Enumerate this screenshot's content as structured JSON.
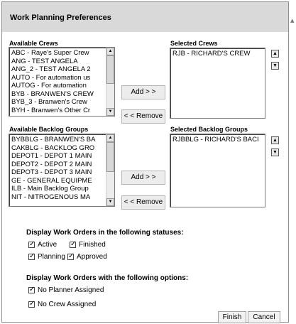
{
  "title": "Work Planning Preferences",
  "crews": {
    "available_label": "Available Crews",
    "selected_label": "Selected Crews",
    "available": [
      "ABC - Raye's Super Crew",
      "ANG - TEST ANGELA",
      "ANG_2 - TEST ANGELA 2",
      "AUTO - For automation us",
      "AUTOG - For automation",
      "BYB - BRANWEN'S CREW",
      "BYB_3 - Branwen's Crew",
      "BYH - Branwen's Other Cr"
    ],
    "selected": [
      "RJB - RICHARD'S CREW"
    ],
    "add_label": "Add > >",
    "remove_label": "< < Remove"
  },
  "backlog": {
    "available_label": "Available Backlog Groups",
    "selected_label": "Selected Backlog Groups",
    "available": [
      "BYBBLG - BRANWEN'S BA",
      "CAKBLG - BACKLOG GRO",
      "DEPOT1 - DEPOT 1 MAIN",
      "DEPOT2 - DEPOT 2 MAIN",
      "DEPOT3 - DEPOT 3 MAIN",
      "GE - GENERAL EQUIPME",
      "ILB - Main Backlog Group",
      "NIT - NITROGENOUS MA"
    ],
    "selected": [
      "RJBBLG - RICHARD'S BACI"
    ],
    "add_label": "Add > >",
    "remove_label": "< < Remove"
  },
  "statuses": {
    "heading": "Display Work Orders in the following statuses:",
    "options": [
      {
        "label": "Active",
        "checked": true
      },
      {
        "label": "Finished",
        "checked": true
      },
      {
        "label": "Planning",
        "checked": true
      },
      {
        "label": "Approved",
        "checked": true
      }
    ]
  },
  "options": {
    "heading": "Display Work Orders with the following options:",
    "items": [
      {
        "label": "No Planner Assigned",
        "checked": true
      },
      {
        "label": "No Crew Assigned",
        "checked": true
      }
    ]
  },
  "footer": {
    "finish_label": "Finish",
    "cancel_label": "Cancel"
  }
}
